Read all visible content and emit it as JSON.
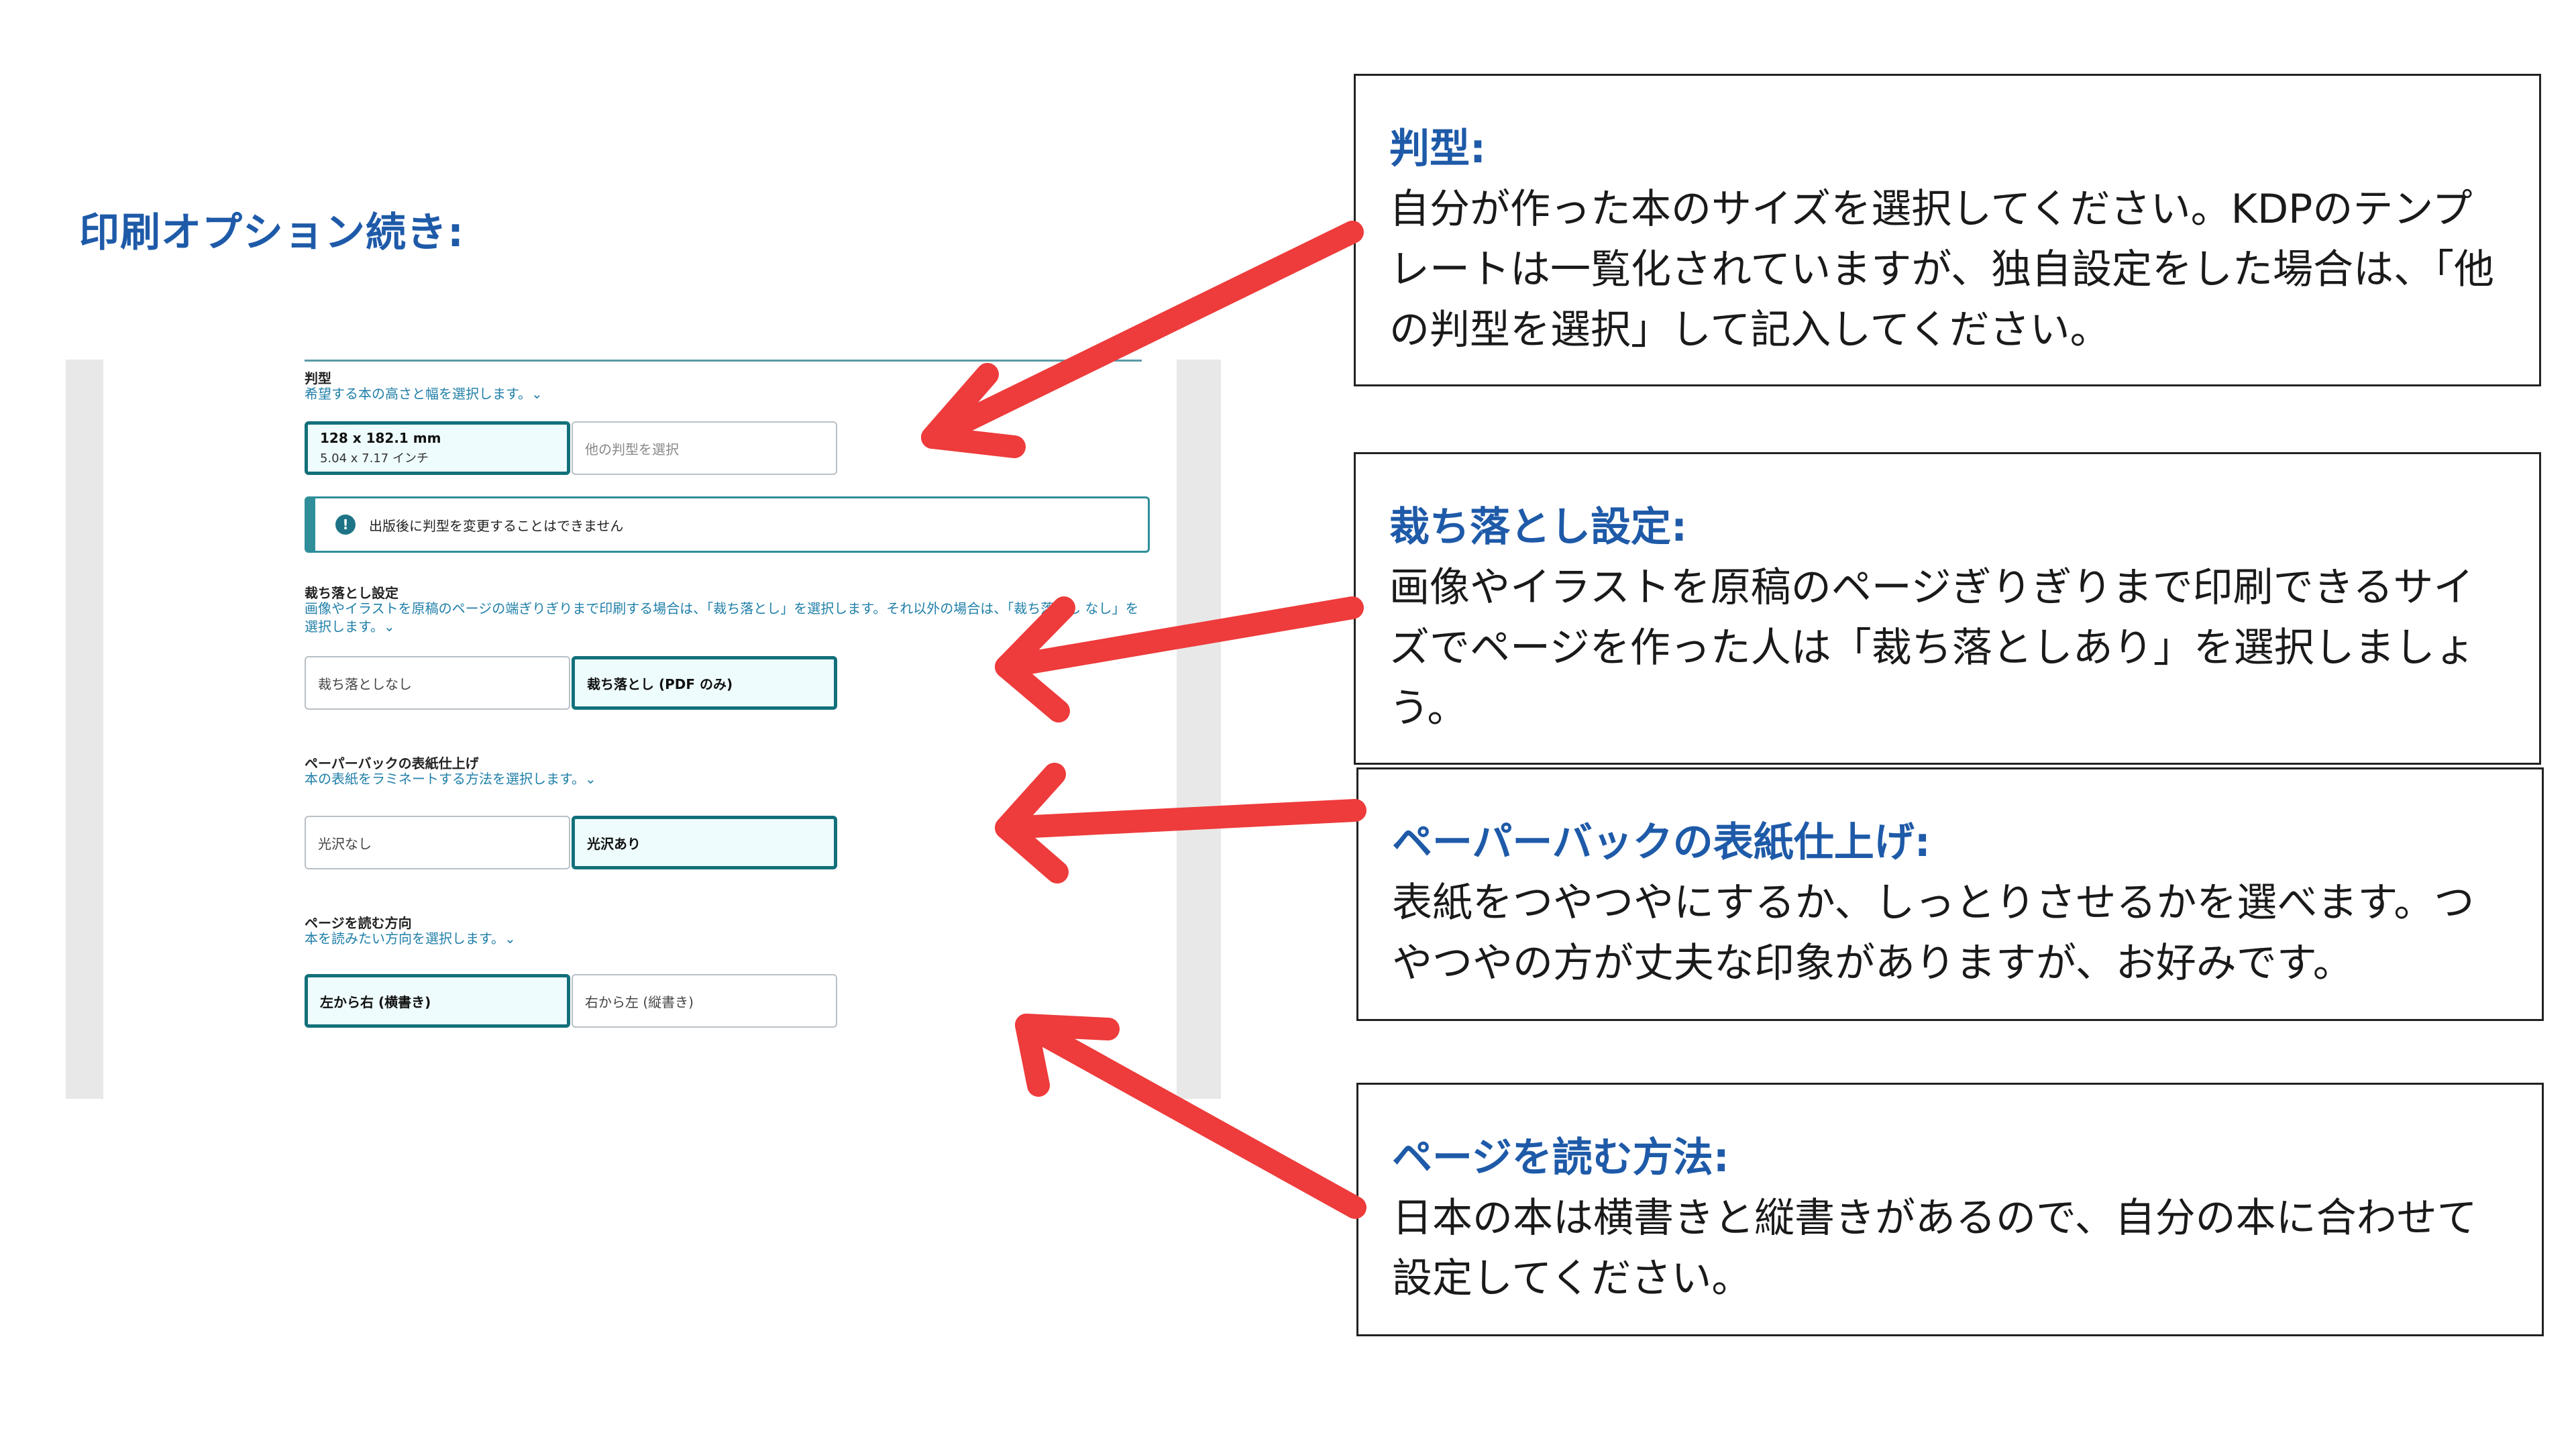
{
  "page_title": "印刷オプション続き:",
  "screenshot": {
    "trim": {
      "title": "判型",
      "desc": "希望する本の高さと幅を選択します。⌄",
      "selected_size_main": "128 x 182.1 mm",
      "selected_size_sub": "5.04 x 7.17 インチ",
      "other_size_label": "他の判型を選択",
      "notice": "出版後に判型を変更することはできません"
    },
    "bleed": {
      "title": "裁ち落とし設定",
      "desc": "画像やイラストを原稿のページの端ぎりぎりまで印刷する場合は、「裁ち落とし」を選択します。それ以外の場合は、「裁ち落とし なし」を選択します。⌄",
      "option_no": "裁ち落としなし",
      "option_yes": "裁ち落とし (PDF のみ)"
    },
    "cover": {
      "title": "ペーパーバックの表紙仕上げ",
      "desc": "本の表紙をラミネートする方法を選択します。⌄",
      "option_matte": "光沢なし",
      "option_gloss": "光沢あり"
    },
    "direction": {
      "title": "ページを読む方向",
      "desc": "本を読みたい方向を選択します。⌄",
      "option_ltr": "左から右 (横書き)",
      "option_rtl": "右から左 (縦書き)"
    }
  },
  "callouts": {
    "trim": {
      "heading": "判型:",
      "body": "自分が作った本のサイズを選択してください。KDPのテンプレートは一覧化されていますが、独自設定をした場合は、「他の判型を選択」して記入してください。"
    },
    "bleed": {
      "heading": "裁ち落とし設定:",
      "body": "画像やイラストを原稿のページぎりぎりまで印刷できるサイズでページを作った人は「裁ち落としあり」を選択しましょう。"
    },
    "cover": {
      "heading": "ペーパーバックの表紙仕上げ:",
      "body": "表紙をつやつやにするか、しっとりさせるかを選べます。つやつやの方が丈夫な印象がありますが、お好みです。"
    },
    "direction": {
      "heading": "ページを読む方法:",
      "body": "日本の本は横書きと縦書きがあるので、自分の本に合わせて設定してください。"
    }
  },
  "colors": {
    "heading_blue": "#1e5aa8",
    "arrow_red": "#ee3b3b",
    "selected_border": "#12707a"
  }
}
